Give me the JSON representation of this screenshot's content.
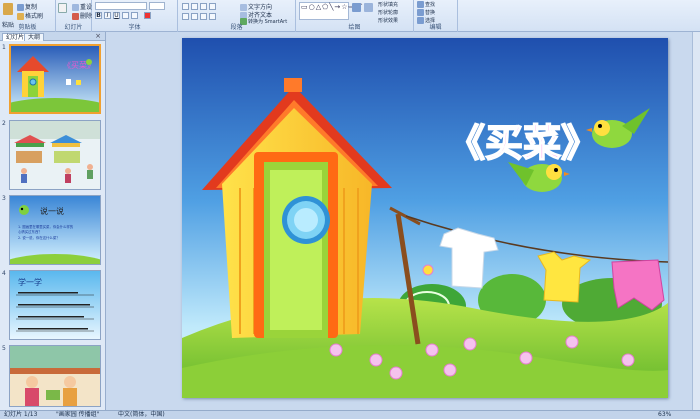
{
  "ribbon": {
    "clipboard": {
      "paste": "粘贴",
      "copy": "复制",
      "format": "格式刷",
      "label": "剪贴板"
    },
    "slides": {
      "new": "新建\n幻灯片",
      "reset": "重设",
      "delete": "删除",
      "label": "幻灯片"
    },
    "font": {
      "label": "字体"
    },
    "paragraph": {
      "label": "段落",
      "text_dir": "文字方向",
      "align": "对齐文本",
      "smartart": "转换为 SmartArt"
    },
    "drawing": {
      "label": "绘图",
      "arrange": "排列",
      "quick_styles": "快速样式",
      "fill": "形状填充",
      "outline": "形状轮廓",
      "effect": "形状效果"
    },
    "editing": {
      "label": "编辑",
      "find": "查找",
      "replace": "替换",
      "select": "选择"
    }
  },
  "pane": {
    "tab_slides": "幻灯片",
    "tab_outline": "大纲",
    "close": "×"
  },
  "thumbs": [
    {
      "num": "1",
      "title": "《买菜》"
    },
    {
      "num": "2"
    },
    {
      "num": "3",
      "title": "说一说",
      "lines": [
        "1. 图画里在哪里买菜，你会什么样的",
        "   心情买过东西？",
        "2. 说一说，你在这什么菜？"
      ]
    },
    {
      "num": "4",
      "title": "学一学"
    },
    {
      "num": "5"
    }
  ],
  "slide": {
    "title": "《买菜》"
  },
  "status": {
    "slide_info": "幻灯片 1/13",
    "theme": "\"画家园 传播组\"",
    "lang": "中文(简体，中国)",
    "zoom": "63%"
  }
}
